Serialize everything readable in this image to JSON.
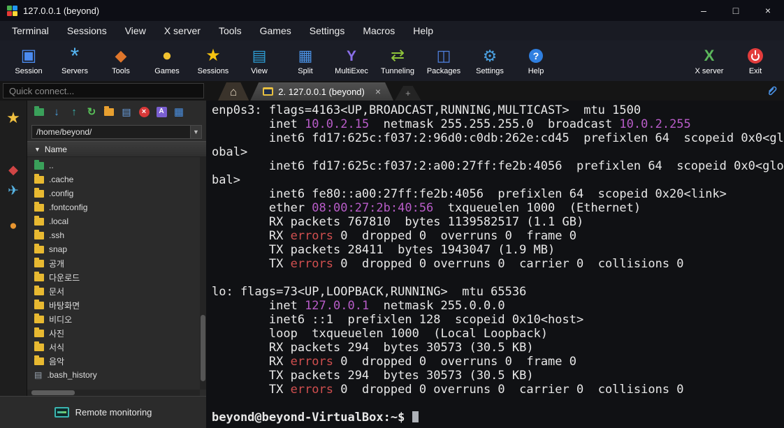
{
  "window": {
    "title": "127.0.0.1 (beyond)",
    "minimize": "–",
    "maximize": "□",
    "close": "×"
  },
  "menu": {
    "items": [
      "Terminal",
      "Sessions",
      "View",
      "X server",
      "Tools",
      "Games",
      "Settings",
      "Macros",
      "Help"
    ]
  },
  "toolbar": {
    "items": [
      {
        "label": "Session",
        "icon": "session-icon"
      },
      {
        "label": "Servers",
        "icon": "servers-icon"
      },
      {
        "label": "Tools",
        "icon": "tools-icon"
      },
      {
        "label": "Games",
        "icon": "games-icon"
      },
      {
        "label": "Sessions",
        "icon": "sessions-icon"
      },
      {
        "label": "View",
        "icon": "view-icon"
      },
      {
        "label": "Split",
        "icon": "split-icon"
      },
      {
        "label": "MultiExec",
        "icon": "multiexec-icon"
      },
      {
        "label": "Tunneling",
        "icon": "tunneling-icon"
      },
      {
        "label": "Packages",
        "icon": "packages-icon"
      },
      {
        "label": "Settings",
        "icon": "settings-icon"
      },
      {
        "label": "Help",
        "icon": "help-icon"
      },
      {
        "label": "X server",
        "icon": "xserver-icon",
        "right": true
      },
      {
        "label": "Exit",
        "icon": "exit-icon",
        "right": true
      }
    ]
  },
  "tabbar": {
    "quick_connect_placeholder": "Quick connect...",
    "tabs": [
      {
        "type": "home",
        "icon": "home-icon",
        "label": ""
      },
      {
        "type": "session",
        "icon": "terminal-tab-icon",
        "label": "2. 127.0.0.1 (beyond)",
        "close": "×",
        "active": true
      },
      {
        "type": "new",
        "label": "+"
      }
    ]
  },
  "sidebar": {
    "strip": [
      {
        "icon": "sessions-star-icon"
      },
      {
        "icon": "macros-icon"
      },
      {
        "icon": "sftp-icon"
      },
      {
        "icon": "network-icon"
      }
    ],
    "filebrowser": {
      "toolbar_icons": [
        "folder-up-icon",
        "download-icon",
        "upload-icon",
        "refresh-icon",
        "new-folder-icon",
        "file-doc-icon",
        "delete-icon",
        "rename-icon",
        "panel-icon"
      ],
      "path": "/home/beyond/",
      "column_header": "Name",
      "items": [
        {
          "name": "..",
          "type": "up"
        },
        {
          "name": ".cache",
          "type": "folder"
        },
        {
          "name": ".config",
          "type": "folder"
        },
        {
          "name": ".fontconfig",
          "type": "folder"
        },
        {
          "name": ".local",
          "type": "folder"
        },
        {
          "name": ".ssh",
          "type": "folder"
        },
        {
          "name": "snap",
          "type": "folder"
        },
        {
          "name": "공개",
          "type": "folder"
        },
        {
          "name": "다운로드",
          "type": "folder"
        },
        {
          "name": "문서",
          "type": "folder"
        },
        {
          "name": "바탕화면",
          "type": "folder"
        },
        {
          "name": "비디오",
          "type": "folder"
        },
        {
          "name": "사진",
          "type": "folder"
        },
        {
          "name": "서식",
          "type": "folder"
        },
        {
          "name": "음악",
          "type": "folder"
        },
        {
          "name": ".bash_history",
          "type": "file"
        }
      ]
    },
    "footer": {
      "label": "Remote monitoring",
      "icon": "monitor-icon"
    }
  },
  "terminal": {
    "colors": {
      "fg": "#e8e8e8",
      "magenta": "#b85cc8",
      "red": "#d14f4f"
    },
    "lines": [
      [
        [
          "enp0s3: flags=4163<UP,BROADCAST,RUNNING,MULTICAST>  mtu 1500",
          "fg"
        ]
      ],
      [
        [
          "        inet ",
          "fg"
        ],
        [
          "10.0.2.15",
          "magenta"
        ],
        [
          "  netmask 255.255.255.0  broadcast ",
          "fg"
        ],
        [
          "10.0.2.255",
          "magenta"
        ]
      ],
      [
        [
          "        inet6 fd17:625c:f037:2:96d0:c0db:262e:cd45  prefixlen 64  scopeid 0x0<gl",
          "fg"
        ]
      ],
      [
        [
          "obal>",
          "fg"
        ]
      ],
      [
        [
          "        inet6 fd17:625c:f037:2:a00:27ff:fe2b:4056  prefixlen 64  scopeid 0x0<glo",
          "fg"
        ]
      ],
      [
        [
          "bal>",
          "fg"
        ]
      ],
      [
        [
          "        inet6 fe80::a00:27ff:fe2b:4056  prefixlen 64  scopeid 0x20<link>",
          "fg"
        ]
      ],
      [
        [
          "        ether ",
          "fg"
        ],
        [
          "08:00:27:2b:40:56",
          "magenta"
        ],
        [
          "  txqueuelen 1000  (Ethernet)",
          "fg"
        ]
      ],
      [
        [
          "        RX packets 767810  bytes 1139582517 (1.1 GB)",
          "fg"
        ]
      ],
      [
        [
          "        RX ",
          "fg"
        ],
        [
          "errors",
          "red"
        ],
        [
          " 0  dropped 0  overruns 0  frame 0",
          "fg"
        ]
      ],
      [
        [
          "        TX packets 28411  bytes 1943047 (1.9 MB)",
          "fg"
        ]
      ],
      [
        [
          "        TX ",
          "fg"
        ],
        [
          "errors",
          "red"
        ],
        [
          " 0  dropped 0 overruns 0  carrier 0  collisions 0",
          "fg"
        ]
      ],
      [],
      [
        [
          "lo: flags=73<UP,LOOPBACK,RUNNING>  mtu 65536",
          "fg"
        ]
      ],
      [
        [
          "        inet ",
          "fg"
        ],
        [
          "127.0.0.1",
          "magenta"
        ],
        [
          "  netmask 255.0.0.0",
          "fg"
        ]
      ],
      [
        [
          "        inet6 ::1  prefixlen 128  scopeid 0x10<host>",
          "fg"
        ]
      ],
      [
        [
          "        loop  txqueuelen 1000  (Local Loopback)",
          "fg"
        ]
      ],
      [
        [
          "        RX packets 294  bytes 30573 (30.5 KB)",
          "fg"
        ]
      ],
      [
        [
          "        RX ",
          "fg"
        ],
        [
          "errors",
          "red"
        ],
        [
          " 0  dropped 0  overruns 0  frame 0",
          "fg"
        ]
      ],
      [
        [
          "        TX packets 294  bytes 30573 (30.5 KB)",
          "fg"
        ]
      ],
      [
        [
          "        TX ",
          "fg"
        ],
        [
          "errors",
          "red"
        ],
        [
          " 0  dropped 0 overruns 0  carrier 0  collisions 0",
          "fg"
        ]
      ],
      []
    ],
    "prompt": "beyond@beyond-VirtualBox:~$"
  }
}
